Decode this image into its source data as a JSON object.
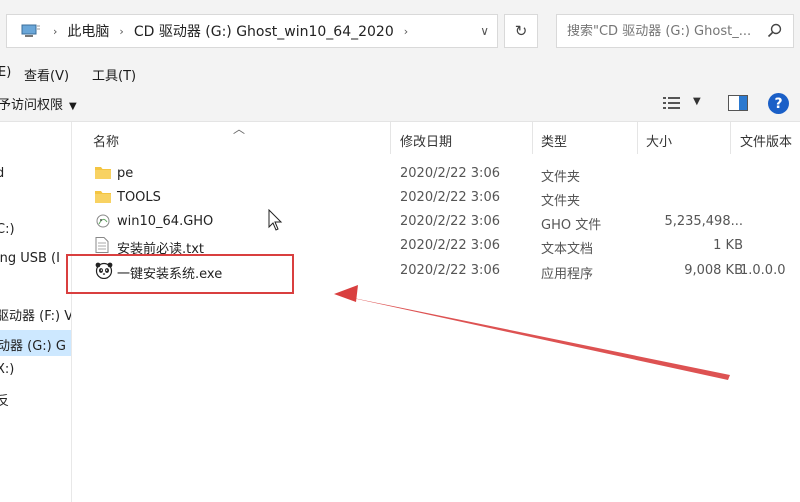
{
  "address_bar": {
    "breadcrumbs": [
      "此电脑",
      "CD 驱动器 (G:) Ghost_win10_64_2020"
    ],
    "search_placeholder": "搜索\"CD 驱动器 (G:) Ghost_..."
  },
  "menu": {
    "view": "查看(V)",
    "tools": "工具(T)",
    "partial_left": "E)"
  },
  "toolbar": {
    "share": "予访问权限"
  },
  "nav": {
    "items": [
      {
        "label": "d"
      },
      {
        "label": "C:)"
      },
      {
        "label": "ing USB (I"
      },
      {
        "label": ")"
      },
      {
        "label": "驱动器 (F:) V"
      },
      {
        "label": "动器 (G:) G"
      },
      {
        "label": "X:)"
      },
      {
        "label": "反"
      }
    ]
  },
  "columns": {
    "name": "名称",
    "date": "修改日期",
    "type": "类型",
    "size": "大小",
    "version": "文件版本"
  },
  "files": [
    {
      "name": "pe",
      "date": "2020/2/22 3:06",
      "type": "文件夹",
      "size": "",
      "version": "",
      "icon": "folder-icon"
    },
    {
      "name": "TOOLS",
      "date": "2020/2/22 3:06",
      "type": "文件夹",
      "size": "",
      "version": "",
      "icon": "folder-icon"
    },
    {
      "name": "win10_64.GHO",
      "date": "2020/2/22 3:06",
      "type": "GHO 文件",
      "size": "5,235,498...",
      "version": "",
      "icon": "gho-file-icon"
    },
    {
      "name": "安装前必读.txt",
      "date": "2020/2/22 3:06",
      "type": "文本文档",
      "size": "1 KB",
      "version": "",
      "icon": "text-file-icon"
    },
    {
      "name": "一键安装系统.exe",
      "date": "2020/2/22 3:06",
      "type": "应用程序",
      "size": "9,008 KB",
      "version": "1.0.0.0",
      "icon": "panda-app-icon"
    }
  ],
  "colors": {
    "highlight": "#d93f3f",
    "selected_nav": "#cde8ff",
    "folder": "#f4c542",
    "help": "#1a5fc7"
  }
}
